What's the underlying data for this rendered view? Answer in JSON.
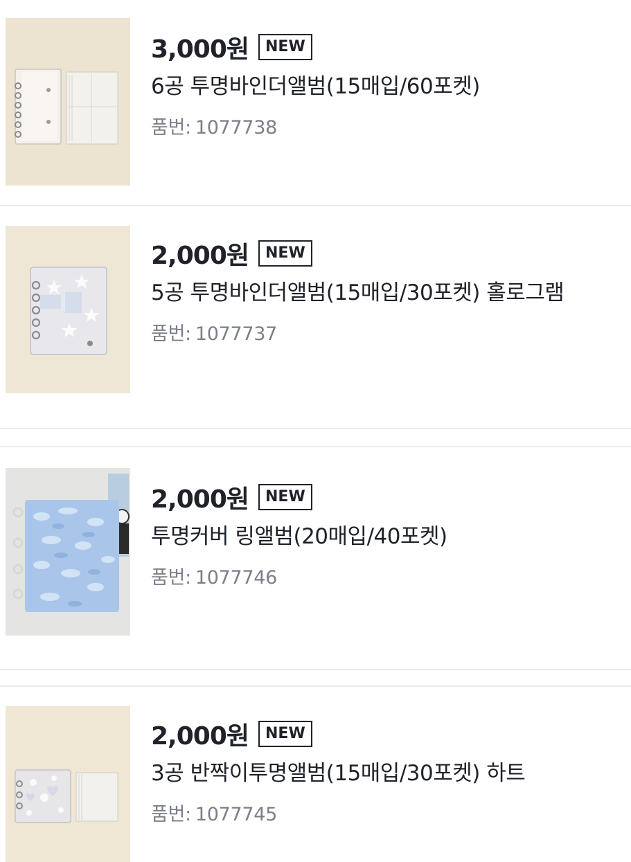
{
  "products": [
    {
      "price": "3,000원",
      "badge": "NEW",
      "name": "6공 투명바인더앨범(15매입/60포켓)",
      "code_label": "품번:",
      "code": "1077738",
      "image": "clear-binder-album-6ring-photo"
    },
    {
      "price": "2,000원",
      "badge": "NEW",
      "name": "5공 투명바인더앨범(15매입/30포켓) 홀로그램",
      "code_label": "품번:",
      "code": "1077737",
      "image": "hologram-binder-album-5ring-photo"
    },
    {
      "price": "2,000원",
      "badge": "NEW",
      "name": "투명커버 링앨범(20매입/40포켓)",
      "code_label": "품번:",
      "code": "1077746",
      "image": "blue-water-ring-album-photo"
    },
    {
      "price": "2,000원",
      "badge": "NEW",
      "name": "3공 반짝이투명앨범(15매입/30포켓) 하트",
      "code_label": "품번:",
      "code": "1077745",
      "image": "glitter-heart-album-3ring-photo"
    }
  ]
}
